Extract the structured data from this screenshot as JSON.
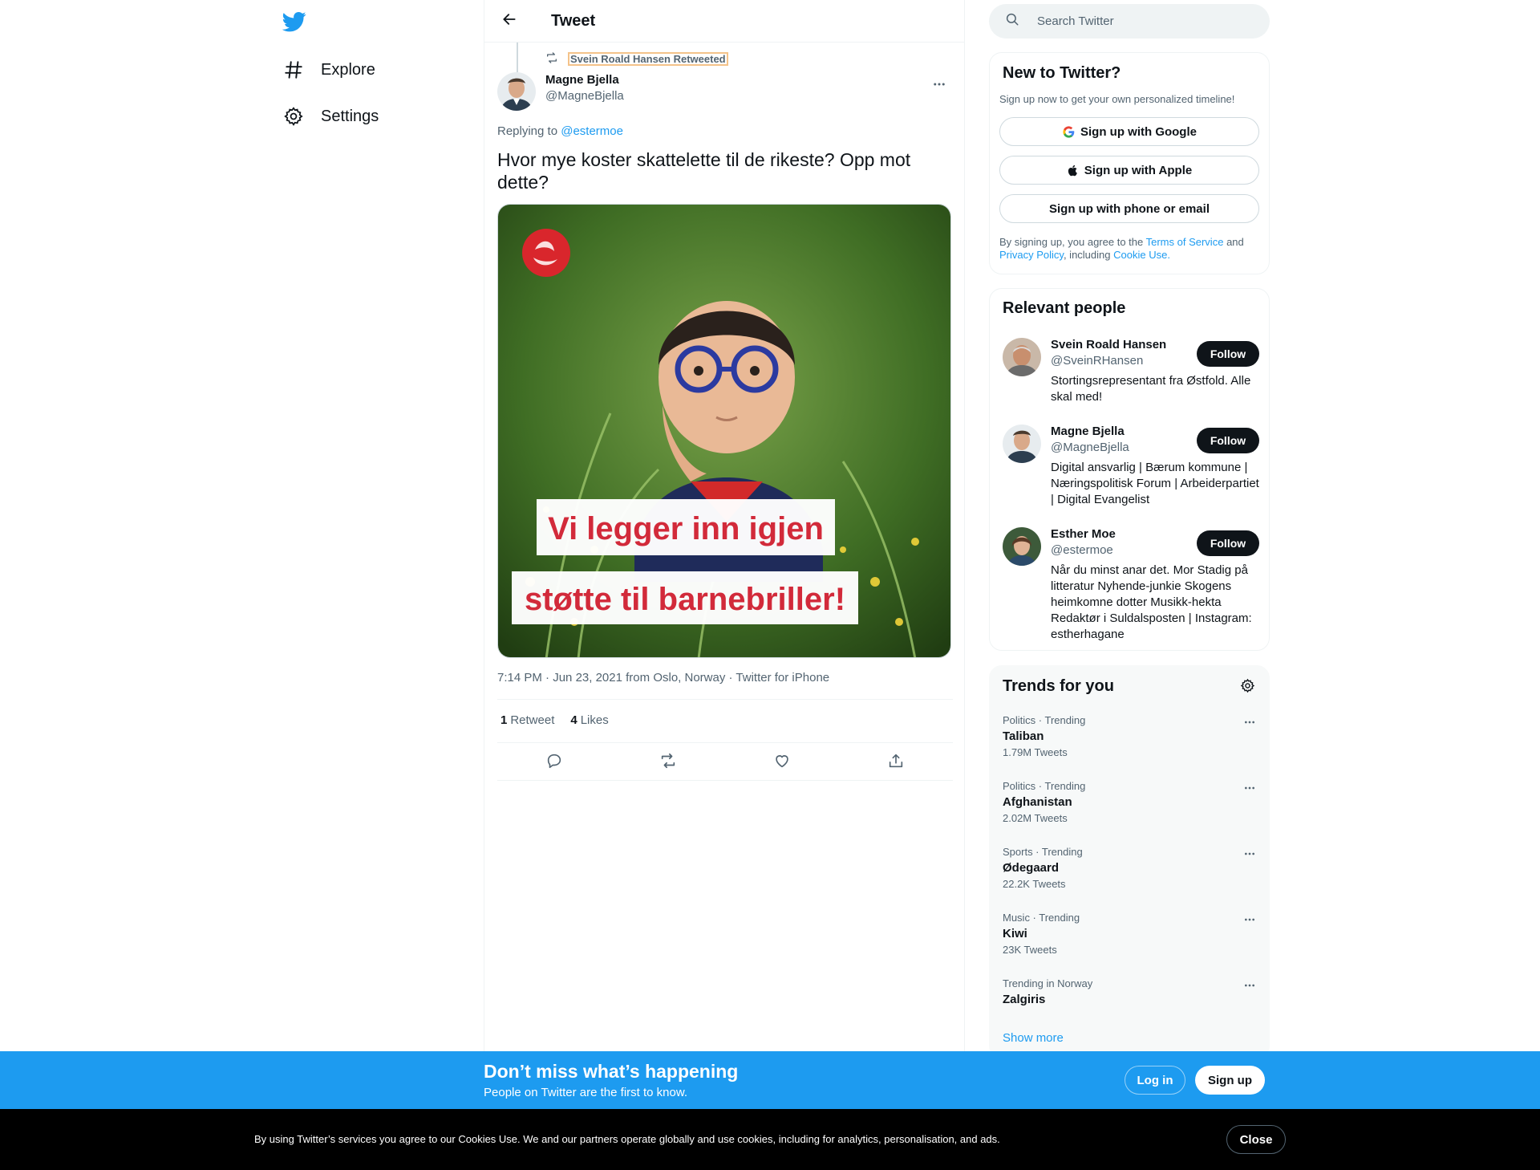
{
  "nav": {
    "logo": "twitter-bird-icon",
    "items": [
      {
        "label": "Explore",
        "icon": "hashtag-icon"
      },
      {
        "label": "Settings",
        "icon": "gear-icon"
      }
    ]
  },
  "header": {
    "title": "Tweet"
  },
  "tweet": {
    "retweeted_by": "Svein Roald Hansen Retweeted",
    "author": {
      "name": "Magne Bjella",
      "handle": "@MagneBjella"
    },
    "replying_prefix": "Replying to",
    "replying_to": "@estermoe",
    "text": "Hvor mye koster skattelette til de rikeste? Opp mot dette?",
    "image": {
      "line1": "Vi legger inn igjen",
      "line2": "støtte til barnebriller!"
    },
    "time": "7:14 PM",
    "date": "Jun 23, 2021",
    "location_prefix": "from",
    "location": "Oslo, Norway",
    "source": "Twitter for iPhone",
    "sep": "·",
    "retweets": {
      "count": "1",
      "label": "Retweet"
    },
    "likes": {
      "count": "4",
      "label": "Likes"
    }
  },
  "search": {
    "placeholder": "Search Twitter"
  },
  "signup": {
    "title": "New to Twitter?",
    "subtitle": "Sign up now to get your own personalized timeline!",
    "google": "Sign up with Google",
    "apple": "Sign up with Apple",
    "phone": "Sign up with phone or email",
    "legal_1": "By signing up, you agree to the",
    "terms": "Terms of Service",
    "legal_2": "and",
    "privacy": "Privacy Policy",
    "legal_3": ", including",
    "cookie": "Cookie Use."
  },
  "people": {
    "title": "Relevant people",
    "follow_label": "Follow",
    "list": [
      {
        "name": "Svein Roald Hansen",
        "handle": "@SveinRHansen",
        "bio": "Stortingsrepresentant fra Østfold. Alle skal med!"
      },
      {
        "name": "Magne Bjella",
        "handle": "@MagneBjella",
        "bio": "Digital ansvarlig | Bærum kommune | Næringspolitisk Forum | Arbeiderpartiet | Digital Evangelist"
      },
      {
        "name": "Esther Moe",
        "handle": "@estermoe",
        "bio": "Når du minst anar det. Mor Stadig på litteratur Nyhende-junkie Skogens heimkomne dotter Musikk-hekta Redaktør i Suldalsposten | Instagram: estherhagane"
      }
    ]
  },
  "trends": {
    "title": "Trends for you",
    "show_more": "Show more",
    "list": [
      {
        "context": "Politics · Trending",
        "name": "Taliban",
        "count": "1.79M Tweets"
      },
      {
        "context": "Politics · Trending",
        "name": "Afghanistan",
        "count": "2.02M Tweets"
      },
      {
        "context": "Sports · Trending",
        "name": "Ødegaard",
        "count": "22.2K Tweets"
      },
      {
        "context": "Music · Trending",
        "name": "Kiwi",
        "count": "23K Tweets"
      },
      {
        "context": "Trending in Norway",
        "name": "Zalgiris",
        "count": ""
      }
    ]
  },
  "banner": {
    "title": "Don’t miss what’s happening",
    "subtitle": "People on Twitter are the first to know.",
    "login": "Log in",
    "signup": "Sign up"
  },
  "cookies": {
    "text": "By using Twitter’s services you agree to our Cookies Use. We and our partners operate globally and use cookies, including for analytics, personalisation, and ads.",
    "close": "Close"
  },
  "colors": {
    "accent": "#1d9bf0",
    "text": "#0f1419",
    "muted": "#536471",
    "cookie_bg": "#000000"
  }
}
